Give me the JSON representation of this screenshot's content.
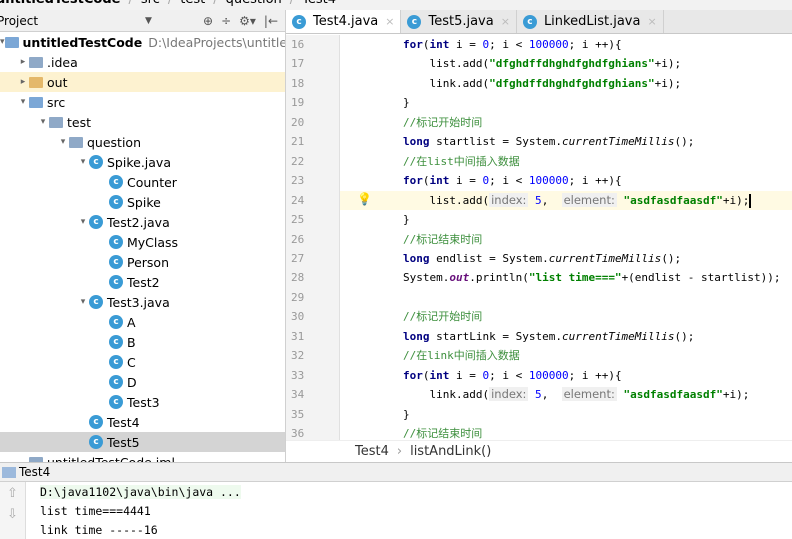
{
  "navbar": {
    "items": [
      "untitledTestCode",
      "src",
      "test",
      "question",
      "Test4"
    ]
  },
  "project": {
    "title": "Project",
    "tools": [
      "⊕",
      "÷",
      "⚙▾",
      "|←"
    ],
    "tree": [
      {
        "label": "untitledTestCode",
        "path": "D:\\IdeaProjects\\untitledTest",
        "depth": 0,
        "arrow": "▾",
        "icon": "module",
        "bold": true
      },
      {
        "label": ".idea",
        "depth": 1,
        "arrow": "▸",
        "icon": "folder"
      },
      {
        "label": "out",
        "depth": 1,
        "arrow": "▸",
        "icon": "folder-y",
        "hl": "out"
      },
      {
        "label": "src",
        "depth": 1,
        "arrow": "▾",
        "icon": "folder-b"
      },
      {
        "label": "test",
        "depth": 2,
        "arrow": "▾",
        "icon": "package"
      },
      {
        "label": "question",
        "depth": 3,
        "arrow": "▾",
        "icon": "package"
      },
      {
        "label": "Spike.java",
        "depth": 4,
        "arrow": "▾",
        "icon": "class"
      },
      {
        "label": "Counter",
        "depth": 5,
        "icon": "class"
      },
      {
        "label": "Spike",
        "depth": 5,
        "icon": "class"
      },
      {
        "label": "Test2.java",
        "depth": 4,
        "arrow": "▾",
        "icon": "class"
      },
      {
        "label": "MyClass",
        "depth": 5,
        "icon": "class"
      },
      {
        "label": "Person",
        "depth": 5,
        "icon": "class"
      },
      {
        "label": "Test2",
        "depth": 5,
        "icon": "class"
      },
      {
        "label": "Test3.java",
        "depth": 4,
        "arrow": "▾",
        "icon": "class"
      },
      {
        "label": "A",
        "depth": 5,
        "icon": "class"
      },
      {
        "label": "B",
        "depth": 5,
        "icon": "class"
      },
      {
        "label": "C",
        "depth": 5,
        "icon": "class"
      },
      {
        "label": "D",
        "depth": 5,
        "icon": "class"
      },
      {
        "label": "Test3",
        "depth": 5,
        "icon": "class"
      },
      {
        "label": "Test4",
        "depth": 4,
        "icon": "class"
      },
      {
        "label": "Test5",
        "depth": 4,
        "icon": "class",
        "hl": "sel"
      },
      {
        "label": "untitledTestCode.iml",
        "depth": 1,
        "icon": "file"
      }
    ]
  },
  "tabs": [
    {
      "label": "Test4.java",
      "active": true
    },
    {
      "label": "Test5.java"
    },
    {
      "label": "LinkedList.java"
    }
  ],
  "code": [
    {
      "n": 16,
      "t": [
        [
          "kw",
          "for"
        ],
        [
          "",
          "("
        ],
        [
          "kw",
          "int"
        ],
        [
          "",
          " i = "
        ],
        [
          "num",
          "0"
        ],
        [
          "",
          "; i < "
        ],
        [
          "num",
          "100000"
        ],
        [
          "",
          "; i ++){"
        ]
      ]
    },
    {
      "n": 17,
      "t": [
        [
          "",
          "    list.add("
        ],
        [
          "str",
          "\"dfghdffdhghdfghdfghians\""
        ],
        [
          "",
          "+i);"
        ]
      ]
    },
    {
      "n": 18,
      "t": [
        [
          "",
          "    link.add("
        ],
        [
          "str",
          "\"dfghdffdhghdfghdfghians\""
        ],
        [
          "",
          "+i);"
        ]
      ]
    },
    {
      "n": 19,
      "t": [
        [
          "",
          "}"
        ]
      ]
    },
    {
      "n": 20,
      "t": [
        [
          "cm",
          "//标记开始时间"
        ]
      ]
    },
    {
      "n": 21,
      "t": [
        [
          "kw",
          "long"
        ],
        [
          "",
          " startlist = System."
        ],
        [
          "it",
          "currentTimeMillis"
        ],
        [
          "",
          "();"
        ]
      ]
    },
    {
      "n": 22,
      "t": [
        [
          "cm",
          "//在list中间插入数据"
        ]
      ]
    },
    {
      "n": 23,
      "t": [
        [
          "kw",
          "for"
        ],
        [
          "",
          "("
        ],
        [
          "kw",
          "int"
        ],
        [
          "",
          " i = "
        ],
        [
          "num",
          "0"
        ],
        [
          "",
          "; i < "
        ],
        [
          "num",
          "100000"
        ],
        [
          "",
          "; i ++){"
        ]
      ]
    },
    {
      "n": 24,
      "cur": true,
      "bulb": true,
      "t": [
        [
          "",
          "    list.add("
        ],
        [
          "hint",
          "index:"
        ],
        [
          "num",
          " 5"
        ],
        [
          "",
          ",  "
        ],
        [
          "hint",
          "element:"
        ],
        [
          "str",
          " \"asdfasdfaasdf\""
        ],
        [
          "",
          "+i);"
        ],
        [
          "caret",
          ""
        ]
      ]
    },
    {
      "n": 25,
      "t": [
        [
          "",
          "}"
        ]
      ]
    },
    {
      "n": 26,
      "t": [
        [
          "cm",
          "//标记结束时间"
        ]
      ]
    },
    {
      "n": 27,
      "t": [
        [
          "kw",
          "long"
        ],
        [
          "",
          " endlist = System."
        ],
        [
          "it",
          "currentTimeMillis"
        ],
        [
          "",
          "();"
        ]
      ]
    },
    {
      "n": 28,
      "t": [
        [
          "",
          "System."
        ],
        [
          "fld",
          "out"
        ],
        [
          "",
          ".println("
        ],
        [
          "str",
          "\"list time===\""
        ],
        [
          "",
          "+(endlist - startlist));"
        ]
      ]
    },
    {
      "n": 29,
      "t": []
    },
    {
      "n": 30,
      "t": [
        [
          "cm",
          "//标记开始时间"
        ]
      ]
    },
    {
      "n": 31,
      "t": [
        [
          "kw",
          "long"
        ],
        [
          "",
          " startLink = System."
        ],
        [
          "it",
          "currentTimeMillis"
        ],
        [
          "",
          "();"
        ]
      ]
    },
    {
      "n": 32,
      "t": [
        [
          "cm",
          "//在link中间插入数据"
        ]
      ]
    },
    {
      "n": 33,
      "t": [
        [
          "kw",
          "for"
        ],
        [
          "",
          "("
        ],
        [
          "kw",
          "int"
        ],
        [
          "",
          " i = "
        ],
        [
          "num",
          "0"
        ],
        [
          "",
          "; i < "
        ],
        [
          "num",
          "100000"
        ],
        [
          "",
          "; i ++){"
        ]
      ]
    },
    {
      "n": 34,
      "t": [
        [
          "",
          "    link.add("
        ],
        [
          "hint",
          "index:"
        ],
        [
          "num",
          " 5"
        ],
        [
          "",
          ",  "
        ],
        [
          "hint",
          "element:"
        ],
        [
          "str",
          " \"asdfasdfaasdf\""
        ],
        [
          "",
          "+i);"
        ]
      ]
    },
    {
      "n": 35,
      "t": [
        [
          "",
          "}"
        ]
      ]
    },
    {
      "n": 36,
      "t": [
        [
          "cm",
          "//标记结束时间"
        ]
      ]
    }
  ],
  "breadcrumb": {
    "class": "Test4",
    "sep": "›",
    "method": "listAndLink()"
  },
  "run": {
    "title": "Test4",
    "lines": [
      "D:\\java1102\\java\\bin\\java ...",
      "list time===4441",
      "link time -----16"
    ]
  }
}
